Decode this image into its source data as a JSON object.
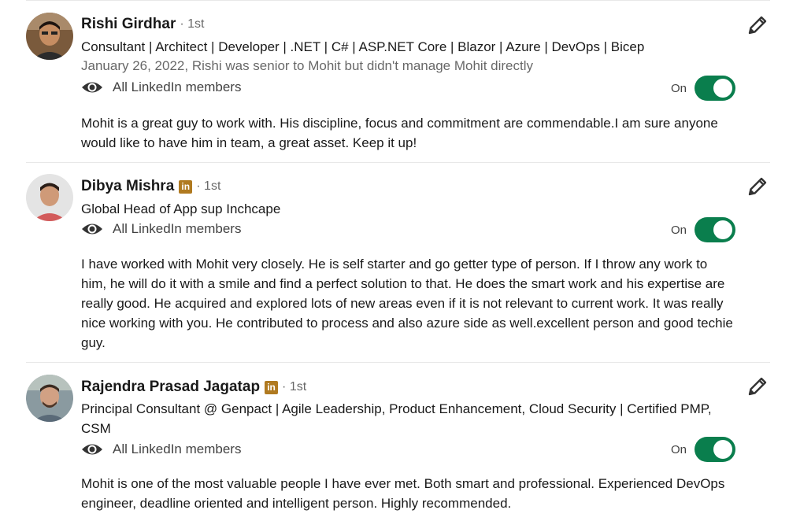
{
  "recommendations": [
    {
      "name": "Rishi Girdhar",
      "has_linkedin_badge": false,
      "degree": "· 1st",
      "headline": "Consultant | Architect | Developer | .NET | C# | ASP.NET Core | Blazor | Azure | DevOps | Bicep",
      "meta": "January 26, 2022, Rishi was senior to Mohit but didn't manage Mohit directly",
      "visibility": "All LinkedIn members",
      "toggle_label": "On",
      "toggle_on": true,
      "text": "Mohit is a great guy to work with. His discipline, focus and commitment are commendable.I am sure anyone would like to have him in team, a great asset. Keep it up!"
    },
    {
      "name": "Dibya Mishra",
      "has_linkedin_badge": true,
      "degree": "· 1st",
      "headline": "Global Head of App sup Inchcape",
      "visibility": "All LinkedIn members",
      "toggle_label": "On",
      "toggle_on": true,
      "text": "I have worked with Mohit very closely. He is self starter and go getter type of person. If I throw any work to him, he will do it with a smile and find a perfect solution to that. He does the smart work and his expertise are really good. He acquired and explored lots of new areas even if it is not relevant to current work. It was really nice working with you. He contributed to process and also azure side as well.excellent person and good techie guy."
    },
    {
      "name": "Rajendra Prasad Jagatap",
      "has_linkedin_badge": true,
      "degree": "· 1st",
      "headline": "Principal Consultant @ Genpact | Agile Leadership, Product Enhancement, Cloud Security | Certified PMP, CSM",
      "visibility": "All LinkedIn members",
      "toggle_label": "On",
      "toggle_on": true,
      "text": "Mohit is one of the most valuable people I have ever met. Both smart and professional. Experienced DevOps engineer, deadline oriented and intelligent person. Highly recommended."
    }
  ],
  "badge_glyph": "in",
  "colors": {
    "toggle_on": "#0a7e4d",
    "linkedin_badge": "#b07a20",
    "divider": "#e8e8e8"
  },
  "icons": {
    "visibility": "eye-icon",
    "edit": "pencil-icon"
  }
}
